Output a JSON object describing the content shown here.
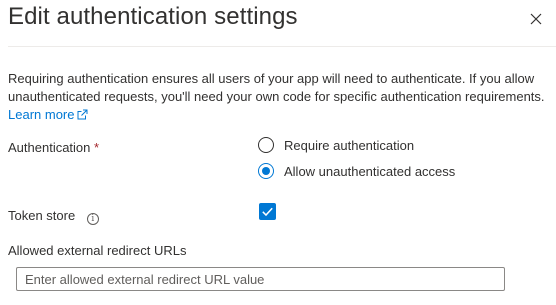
{
  "panel": {
    "title": "Edit authentication settings",
    "close_icon": "close-icon"
  },
  "description": {
    "text": "Requiring authentication ensures all users of your app will need to authenticate. If you allow unauthenticated requests, you'll need your own code for specific authentication requirements.",
    "learn_more": "Learn more",
    "learn_more_icon": "external-link-icon"
  },
  "authentication": {
    "label": "Authentication",
    "required_marker": "*",
    "options": [
      {
        "label": "Require authentication",
        "selected": false
      },
      {
        "label": "Allow unauthenticated access",
        "selected": true
      }
    ]
  },
  "token_store": {
    "label": "Token store",
    "info_icon": "info-icon",
    "checked": true
  },
  "redirect_urls": {
    "label": "Allowed external redirect URLs",
    "value": "",
    "placeholder": "Enter allowed external redirect URL value"
  },
  "colors": {
    "accent": "#0078d4",
    "text": "#323130",
    "required": "#a4262c"
  }
}
